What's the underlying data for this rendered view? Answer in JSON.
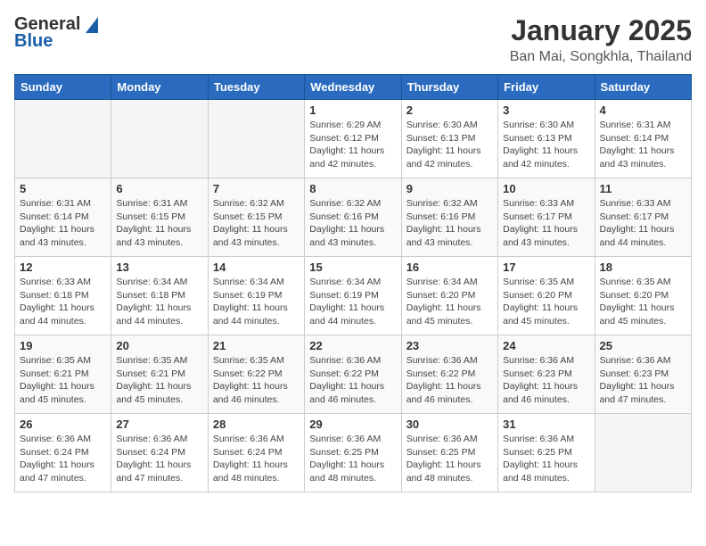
{
  "header": {
    "logo_general": "General",
    "logo_blue": "Blue",
    "month_title": "January 2025",
    "location": "Ban Mai, Songkhla, Thailand"
  },
  "days_of_week": [
    "Sunday",
    "Monday",
    "Tuesday",
    "Wednesday",
    "Thursday",
    "Friday",
    "Saturday"
  ],
  "weeks": [
    [
      {
        "day": "",
        "info": ""
      },
      {
        "day": "",
        "info": ""
      },
      {
        "day": "",
        "info": ""
      },
      {
        "day": "1",
        "info": "Sunrise: 6:29 AM\nSunset: 6:12 PM\nDaylight: 11 hours\nand 42 minutes."
      },
      {
        "day": "2",
        "info": "Sunrise: 6:30 AM\nSunset: 6:13 PM\nDaylight: 11 hours\nand 42 minutes."
      },
      {
        "day": "3",
        "info": "Sunrise: 6:30 AM\nSunset: 6:13 PM\nDaylight: 11 hours\nand 42 minutes."
      },
      {
        "day": "4",
        "info": "Sunrise: 6:31 AM\nSunset: 6:14 PM\nDaylight: 11 hours\nand 43 minutes."
      }
    ],
    [
      {
        "day": "5",
        "info": "Sunrise: 6:31 AM\nSunset: 6:14 PM\nDaylight: 11 hours\nand 43 minutes."
      },
      {
        "day": "6",
        "info": "Sunrise: 6:31 AM\nSunset: 6:15 PM\nDaylight: 11 hours\nand 43 minutes."
      },
      {
        "day": "7",
        "info": "Sunrise: 6:32 AM\nSunset: 6:15 PM\nDaylight: 11 hours\nand 43 minutes."
      },
      {
        "day": "8",
        "info": "Sunrise: 6:32 AM\nSunset: 6:16 PM\nDaylight: 11 hours\nand 43 minutes."
      },
      {
        "day": "9",
        "info": "Sunrise: 6:32 AM\nSunset: 6:16 PM\nDaylight: 11 hours\nand 43 minutes."
      },
      {
        "day": "10",
        "info": "Sunrise: 6:33 AM\nSunset: 6:17 PM\nDaylight: 11 hours\nand 43 minutes."
      },
      {
        "day": "11",
        "info": "Sunrise: 6:33 AM\nSunset: 6:17 PM\nDaylight: 11 hours\nand 44 minutes."
      }
    ],
    [
      {
        "day": "12",
        "info": "Sunrise: 6:33 AM\nSunset: 6:18 PM\nDaylight: 11 hours\nand 44 minutes."
      },
      {
        "day": "13",
        "info": "Sunrise: 6:34 AM\nSunset: 6:18 PM\nDaylight: 11 hours\nand 44 minutes."
      },
      {
        "day": "14",
        "info": "Sunrise: 6:34 AM\nSunset: 6:19 PM\nDaylight: 11 hours\nand 44 minutes."
      },
      {
        "day": "15",
        "info": "Sunrise: 6:34 AM\nSunset: 6:19 PM\nDaylight: 11 hours\nand 44 minutes."
      },
      {
        "day": "16",
        "info": "Sunrise: 6:34 AM\nSunset: 6:20 PM\nDaylight: 11 hours\nand 45 minutes."
      },
      {
        "day": "17",
        "info": "Sunrise: 6:35 AM\nSunset: 6:20 PM\nDaylight: 11 hours\nand 45 minutes."
      },
      {
        "day": "18",
        "info": "Sunrise: 6:35 AM\nSunset: 6:20 PM\nDaylight: 11 hours\nand 45 minutes."
      }
    ],
    [
      {
        "day": "19",
        "info": "Sunrise: 6:35 AM\nSunset: 6:21 PM\nDaylight: 11 hours\nand 45 minutes."
      },
      {
        "day": "20",
        "info": "Sunrise: 6:35 AM\nSunset: 6:21 PM\nDaylight: 11 hours\nand 45 minutes."
      },
      {
        "day": "21",
        "info": "Sunrise: 6:35 AM\nSunset: 6:22 PM\nDaylight: 11 hours\nand 46 minutes."
      },
      {
        "day": "22",
        "info": "Sunrise: 6:36 AM\nSunset: 6:22 PM\nDaylight: 11 hours\nand 46 minutes."
      },
      {
        "day": "23",
        "info": "Sunrise: 6:36 AM\nSunset: 6:22 PM\nDaylight: 11 hours\nand 46 minutes."
      },
      {
        "day": "24",
        "info": "Sunrise: 6:36 AM\nSunset: 6:23 PM\nDaylight: 11 hours\nand 46 minutes."
      },
      {
        "day": "25",
        "info": "Sunrise: 6:36 AM\nSunset: 6:23 PM\nDaylight: 11 hours\nand 47 minutes."
      }
    ],
    [
      {
        "day": "26",
        "info": "Sunrise: 6:36 AM\nSunset: 6:24 PM\nDaylight: 11 hours\nand 47 minutes."
      },
      {
        "day": "27",
        "info": "Sunrise: 6:36 AM\nSunset: 6:24 PM\nDaylight: 11 hours\nand 47 minutes."
      },
      {
        "day": "28",
        "info": "Sunrise: 6:36 AM\nSunset: 6:24 PM\nDaylight: 11 hours\nand 48 minutes."
      },
      {
        "day": "29",
        "info": "Sunrise: 6:36 AM\nSunset: 6:25 PM\nDaylight: 11 hours\nand 48 minutes."
      },
      {
        "day": "30",
        "info": "Sunrise: 6:36 AM\nSunset: 6:25 PM\nDaylight: 11 hours\nand 48 minutes."
      },
      {
        "day": "31",
        "info": "Sunrise: 6:36 AM\nSunset: 6:25 PM\nDaylight: 11 hours\nand 48 minutes."
      },
      {
        "day": "",
        "info": ""
      }
    ]
  ]
}
